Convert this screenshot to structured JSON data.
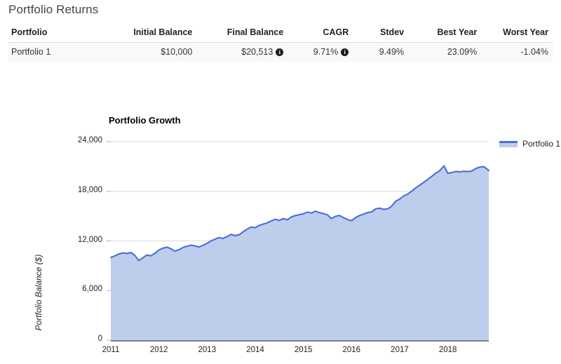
{
  "page": {
    "title": "Portfolio Returns"
  },
  "table": {
    "headers": [
      "Portfolio",
      "Initial Balance",
      "Final Balance",
      "CAGR",
      "Stdev",
      "Best Year",
      "Worst Year"
    ],
    "rows": [
      {
        "portfolio": "Portfolio 1",
        "initial_balance": "$10,000",
        "final_balance": "$20,513",
        "final_balance_info": "i",
        "cagr": "9.71%",
        "cagr_info": "i",
        "stdev": "9.49%",
        "best_year": "23.09%",
        "worst_year": "-1.04%"
      }
    ]
  },
  "chart_data": {
    "type": "area",
    "title": "Portfolio Growth",
    "xlabel": "",
    "ylabel": "Portfolio Balance ($)",
    "legend": [
      "Portfolio 1"
    ],
    "legend_position": "right",
    "grid": true,
    "line_color": "#4a6fd4",
    "fill_color": "#bdcdec",
    "xlim": [
      2011.0,
      2018.85
    ],
    "ylim": [
      0,
      24000
    ],
    "xticks": [
      "2011",
      "2012",
      "2013",
      "2014",
      "2015",
      "2016",
      "2017",
      "2018"
    ],
    "xtick_values": [
      2011,
      2012,
      2013,
      2014,
      2015,
      2016,
      2017,
      2018
    ],
    "yticks": [
      "0",
      "6,000",
      "12,000",
      "18,000",
      "24,000"
    ],
    "ytick_values": [
      0,
      6000,
      12000,
      18000,
      24000
    ],
    "series": [
      {
        "name": "Portfolio 1",
        "x": [
          2011.0,
          2011.08,
          2011.17,
          2011.25,
          2011.33,
          2011.42,
          2011.5,
          2011.58,
          2011.67,
          2011.75,
          2011.83,
          2011.92,
          2012.0,
          2012.08,
          2012.17,
          2012.25,
          2012.33,
          2012.42,
          2012.5,
          2012.58,
          2012.67,
          2012.75,
          2012.83,
          2012.92,
          2013.0,
          2013.08,
          2013.17,
          2013.25,
          2013.33,
          2013.42,
          2013.5,
          2013.58,
          2013.67,
          2013.75,
          2013.83,
          2013.92,
          2014.0,
          2014.08,
          2014.17,
          2014.25,
          2014.33,
          2014.42,
          2014.5,
          2014.58,
          2014.67,
          2014.75,
          2014.83,
          2014.92,
          2015.0,
          2015.08,
          2015.17,
          2015.25,
          2015.33,
          2015.42,
          2015.5,
          2015.58,
          2015.67,
          2015.75,
          2015.83,
          2015.92,
          2016.0,
          2016.08,
          2016.17,
          2016.25,
          2016.33,
          2016.42,
          2016.5,
          2016.58,
          2016.67,
          2016.75,
          2016.83,
          2016.92,
          2017.0,
          2017.08,
          2017.17,
          2017.25,
          2017.33,
          2017.42,
          2017.5,
          2017.58,
          2017.67,
          2017.75,
          2017.83,
          2017.92,
          2018.0,
          2018.08,
          2018.17,
          2018.25,
          2018.33,
          2018.42,
          2018.5,
          2018.58,
          2018.67,
          2018.75,
          2018.85
        ],
        "y": [
          10000,
          10180,
          10420,
          10560,
          10480,
          10600,
          10250,
          9620,
          9980,
          10300,
          10200,
          10520,
          10900,
          11120,
          11240,
          11050,
          10760,
          10960,
          11200,
          11350,
          11480,
          11400,
          11260,
          11480,
          11720,
          12000,
          12220,
          12400,
          12300,
          12540,
          12800,
          12640,
          12760,
          13100,
          13420,
          13680,
          13600,
          13880,
          14050,
          14180,
          14420,
          14620,
          14480,
          14700,
          14560,
          14900,
          15060,
          15180,
          15280,
          15480,
          15380,
          15600,
          15420,
          15300,
          15160,
          14700,
          14980,
          15080,
          14820,
          14580,
          14450,
          14800,
          15080,
          15240,
          15420,
          15520,
          15880,
          15960,
          15820,
          15880,
          16180,
          16820,
          17060,
          17420,
          17680,
          18020,
          18400,
          18760,
          19080,
          19440,
          19820,
          20200,
          20480,
          21080,
          20180,
          20260,
          20400,
          20340,
          20420,
          20380,
          20460,
          20760,
          20940,
          20980,
          20513
        ]
      }
    ]
  }
}
